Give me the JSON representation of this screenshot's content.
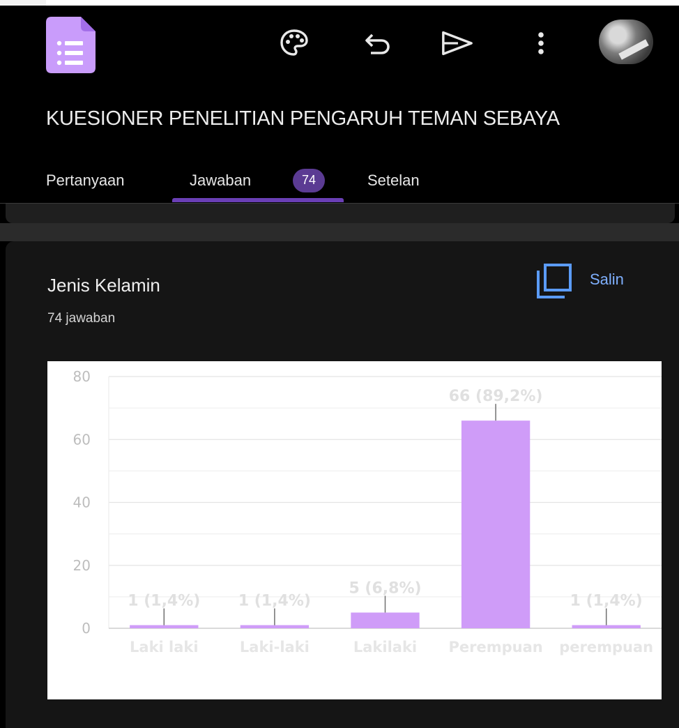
{
  "app": {
    "icons": [
      "forms-logo",
      "palette-icon",
      "undo-icon",
      "send-icon",
      "more-vert-icon",
      "avatar"
    ],
    "accent_color": "#c99cfb"
  },
  "form": {
    "title": "KUESIONER PENELITIAN PENGARUH TEMAN SEBAYA"
  },
  "tabs": {
    "questions": "Pertanyaan",
    "responses": "Jawaban",
    "responses_count": "74",
    "settings": "Setelan",
    "active": "Jawaban"
  },
  "question": {
    "title": "Jenis Kelamin",
    "response_count": "74 jawaban",
    "copy_label": "Salin"
  },
  "chart_data": {
    "type": "bar",
    "categories": [
      "Laki laki",
      "Laki-laki",
      "Lakilaki",
      "Perempuan",
      "perempuan"
    ],
    "values": [
      1,
      1,
      5,
      66,
      1
    ],
    "data_labels": [
      "1 (1,4%)",
      "1 (1,4%)",
      "5 (6,8%)",
      "66 (89,2%)",
      "1 (1,4%)"
    ],
    "yticks": [
      0,
      20,
      40,
      60,
      80
    ],
    "ylim": [
      0,
      80
    ],
    "grid": true,
    "bar_color": "#cf9cf8"
  }
}
